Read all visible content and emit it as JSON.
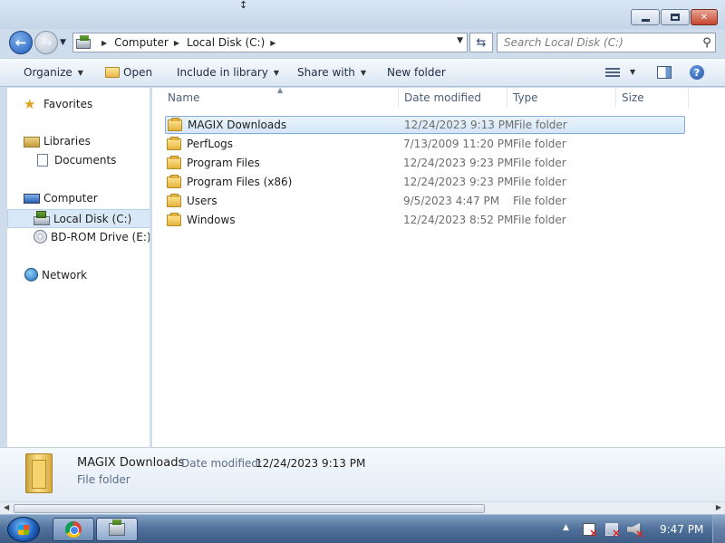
{
  "address": {
    "crumbs": [
      "Computer",
      "Local Disk (C:)"
    ]
  },
  "search": {
    "placeholder": "Search Local Disk (C:)"
  },
  "toolbar": {
    "organize": "Organize",
    "open": "Open",
    "include_in_library": "Include in library",
    "share_with": "Share with",
    "new_folder": "New folder"
  },
  "nav": {
    "favorites": "Favorites",
    "libraries": "Libraries",
    "documents": "Documents",
    "computer": "Computer",
    "local_disk": "Local Disk (C:)",
    "bd_rom": "BD-ROM Drive (E:) v",
    "network": "Network"
  },
  "columns": {
    "name": "Name",
    "date_modified": "Date modified",
    "type": "Type",
    "size": "Size"
  },
  "files": [
    {
      "name": "MAGIX Downloads",
      "date": "12/24/2023 9:13 PM",
      "type": "File folder"
    },
    {
      "name": "PerfLogs",
      "date": "7/13/2009 11:20 PM",
      "type": "File folder"
    },
    {
      "name": "Program Files",
      "date": "12/24/2023 9:23 PM",
      "type": "File folder"
    },
    {
      "name": "Program Files (x86)",
      "date": "12/24/2023 9:23 PM",
      "type": "File folder"
    },
    {
      "name": "Users",
      "date": "9/5/2023 4:47 PM",
      "type": "File folder"
    },
    {
      "name": "Windows",
      "date": "12/24/2023 8:52 PM",
      "type": "File folder"
    }
  ],
  "selected_index": 0,
  "details": {
    "name": "MAGIX Downloads",
    "date_label": "Date modified:",
    "date_value": "12/24/2023 9:13 PM",
    "type": "File folder"
  },
  "taskbar": {
    "clock": "9:47 PM"
  },
  "icons": {
    "back": "back-arrow-icon",
    "forward": "forward-arrow-icon",
    "refresh": "refresh-icon",
    "search": "search-icon",
    "folder": "folder-icon",
    "help": "help-icon"
  },
  "colors": {
    "selection": "#d4e6f8",
    "selection_border": "#84acdd",
    "chrome": "#cfdcec"
  }
}
